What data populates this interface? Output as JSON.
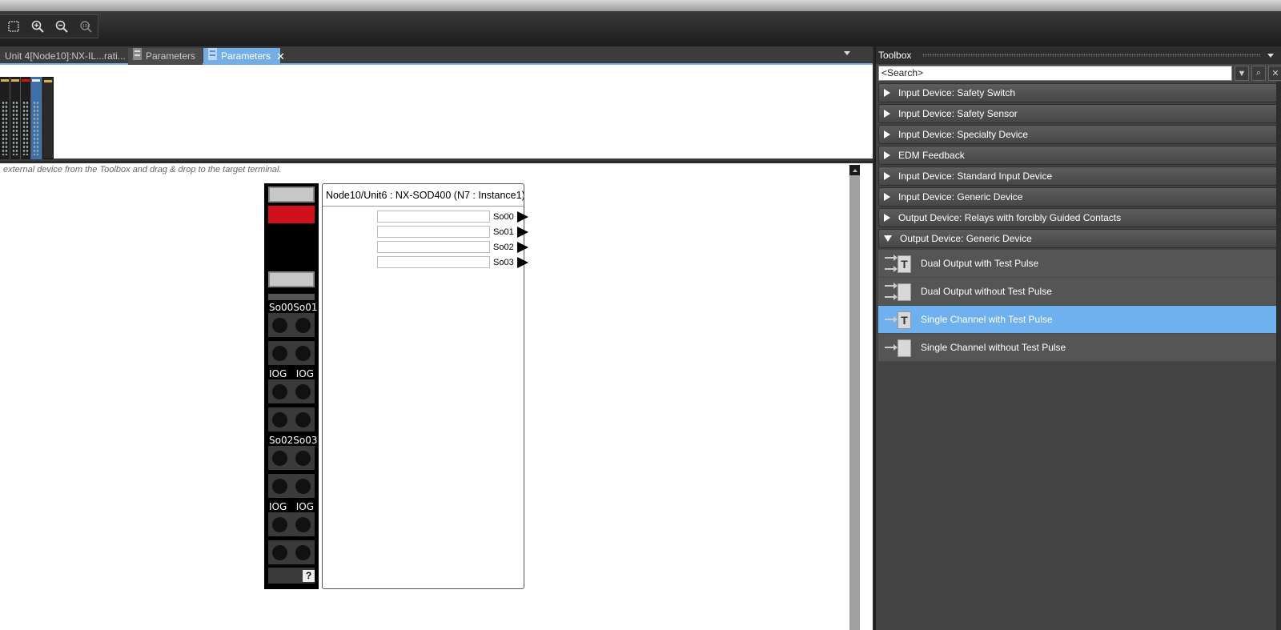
{
  "toolbar": {
    "buttons": [
      "fit-to-window-icon",
      "zoom-in-icon",
      "zoom-out-icon",
      "zoom-100-icon"
    ]
  },
  "editor": {
    "tabs": [
      {
        "label": "Unit 4[Node10]:NX-IL...rati..."
      },
      {
        "label": "Parameters"
      },
      {
        "label": "Parameters",
        "active": true,
        "close": "✕"
      }
    ],
    "hint": "external device from the Toolbox and drag & drop to the target terminal.",
    "device": {
      "title": "Node10/Unit6 : NX-SOD400 (N7 : Instance1)",
      "terminal_labels": [
        [
          "So00",
          "So01"
        ],
        [
          "IOG",
          "IOG"
        ],
        [
          "So02",
          "So03"
        ],
        [
          "IOG",
          "IOG"
        ]
      ],
      "help": "?",
      "outputs": [
        "So00",
        "So01",
        "So02",
        "So03"
      ]
    }
  },
  "toolbox": {
    "title": "Toolbox",
    "search_placeholder": "<Search>",
    "categories": [
      {
        "label": "Input Device: Safety Switch",
        "expanded": false
      },
      {
        "label": "Input Device: Safety Sensor",
        "expanded": false
      },
      {
        "label": "Input Device: Specialty Device",
        "expanded": false
      },
      {
        "label": "EDM Feedback",
        "expanded": false
      },
      {
        "label": "Input Device: Standard Input Device",
        "expanded": false
      },
      {
        "label": "Input Device: Generic Device",
        "expanded": false
      },
      {
        "label": "Output Device: Relays with forcibly Guided Contacts",
        "expanded": false
      },
      {
        "label": "Output Device: Generic Device",
        "expanded": true
      }
    ],
    "items": [
      {
        "label": "Dual Output with Test Pulse",
        "icon": "dual-output-test-pulse-icon",
        "icon_text": "T",
        "selected": false
      },
      {
        "label": "Dual Output without Test Pulse",
        "icon": "dual-output-icon",
        "icon_text": "",
        "selected": false
      },
      {
        "label": "Single Channel with Test Pulse",
        "icon": "single-channel-test-pulse-icon",
        "icon_text": "T",
        "selected": true
      },
      {
        "label": "Single Channel without Test Pulse",
        "icon": "single-channel-icon",
        "icon_text": "",
        "selected": false
      }
    ],
    "colors": {
      "selected": "#6fb0ee",
      "category_bg": "#4f4f4f"
    }
  }
}
